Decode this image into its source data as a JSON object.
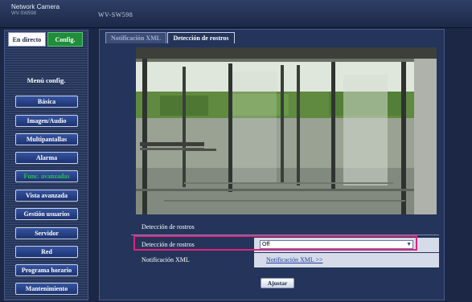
{
  "header": {
    "brand": "Network Camera",
    "brand_model": "WV-SW598",
    "model": "WV-SW598"
  },
  "mode": {
    "live_label": "En directo",
    "config_label": "Config."
  },
  "menu": {
    "title": "Menú config.",
    "items": [
      {
        "label": "Básica"
      },
      {
        "label": "Imagen/Audio"
      },
      {
        "label": "Multipantallas"
      },
      {
        "label": "Alarma"
      },
      {
        "label": "Func. avanzadas",
        "active": true
      },
      {
        "label": "Vista avanzada"
      },
      {
        "label": "Gestión usuarios"
      },
      {
        "label": "Servidor"
      },
      {
        "label": "Red"
      },
      {
        "label": "Programa horario"
      },
      {
        "label": "Mantenimiento"
      }
    ]
  },
  "tabs": [
    {
      "label": "Notificación XML"
    },
    {
      "label": "Detección de rostros",
      "active": true
    }
  ],
  "face_detection": {
    "section_title": "Detección de rostros",
    "row1_label": "Detección de rostros",
    "row1_value": "Off",
    "row2_label": "Notificación XML",
    "row2_link": "Notificación XML >>",
    "apply_label": "Ajustar"
  },
  "colors": {
    "accent_active": "#28c24a",
    "highlight": "#e0237d",
    "config_button": "#1f8d3a"
  }
}
